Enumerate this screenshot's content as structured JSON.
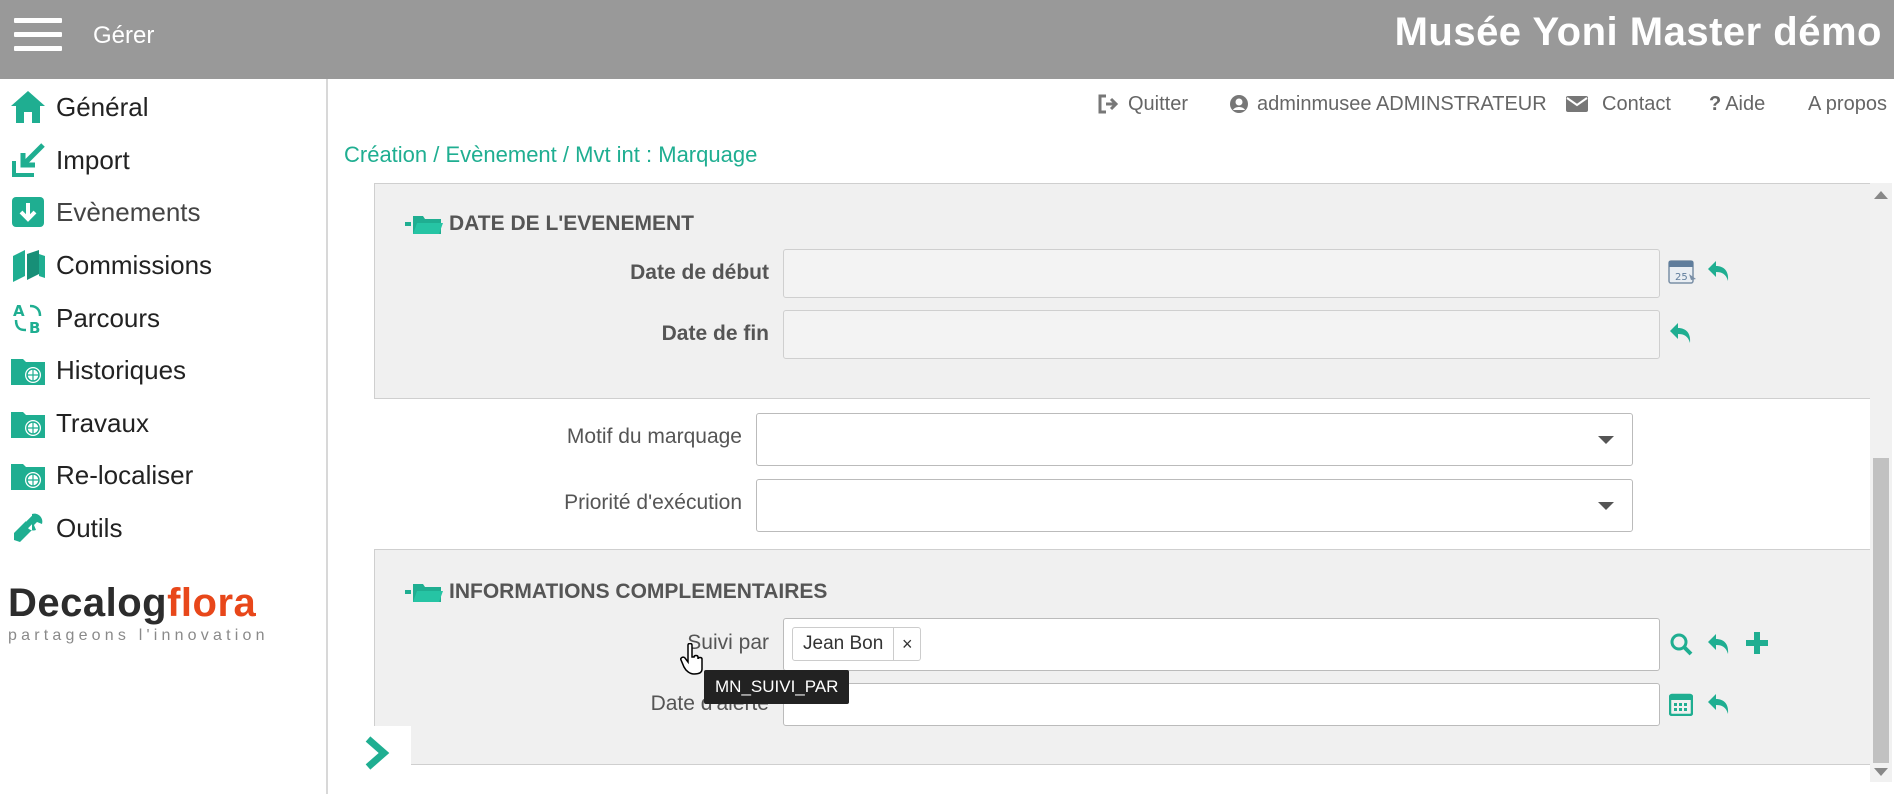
{
  "header": {
    "menu_label": "Gérer",
    "app_title": "Musée Yoni Master démo"
  },
  "sidebar": {
    "items": [
      {
        "label": "Général",
        "icon": "home-icon"
      },
      {
        "label": "Import",
        "icon": "import-icon"
      },
      {
        "label": "Evènements",
        "icon": "events-icon"
      },
      {
        "label": "Commissions",
        "icon": "commissions-icon"
      },
      {
        "label": "Parcours",
        "icon": "parcours-icon"
      },
      {
        "label": "Historiques",
        "icon": "history-folder-icon"
      },
      {
        "label": "Travaux",
        "icon": "travaux-folder-icon"
      },
      {
        "label": "Re-localiser",
        "icon": "relocate-folder-icon"
      },
      {
        "label": "Outils",
        "icon": "wrench-icon"
      }
    ],
    "logo": {
      "brand_part1": "Decalog",
      "brand_part2": "flora",
      "tagline": "partageons l'innovation"
    }
  },
  "utility_bar": {
    "quit": "Quitter",
    "user": "adminmusee ADMINSTRATEUR",
    "contact": "Contact",
    "help": "Aide",
    "about": "A propos"
  },
  "breadcrumb": "Création / Evènement / Mvt int : Marquage",
  "form": {
    "section_date": {
      "title": "DATE DE L'EVENEMENT",
      "start_label": "Date de début",
      "start_value": "",
      "end_label": "Date de fin",
      "end_value": ""
    },
    "motif_label": "Motif du marquage",
    "motif_value": "",
    "priority_label": "Priorité d'exécution",
    "priority_value": "",
    "section_info": {
      "title": "INFORMATIONS COMPLEMENTAIRES",
      "followed_label": "Suivi par",
      "followed_tags": [
        "Jean Bon"
      ],
      "tag_remove": "×",
      "alert_label": "Date d'alerte",
      "alert_value": ""
    },
    "tooltip": "MN_SUIVI_PAR"
  },
  "colors": {
    "accent": "#1fae91",
    "topbar": "#999999",
    "logo_orange": "#e8471a"
  }
}
